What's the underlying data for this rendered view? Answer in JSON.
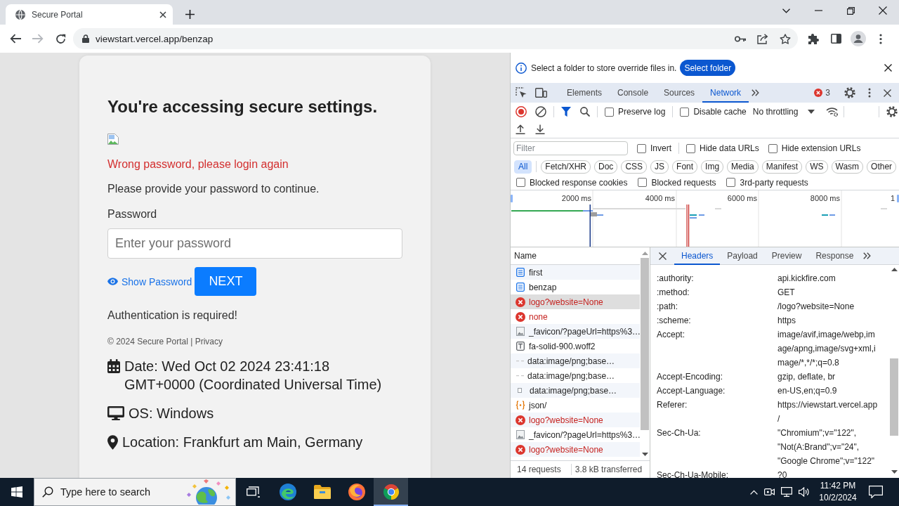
{
  "browser": {
    "tab_title": "Secure Portal",
    "url": "viewstart.vercel.app/benzap"
  },
  "page": {
    "heading": "You're accessing secure settings.",
    "error": "Wrong password, please login again",
    "prompt": "Please provide your password to continue.",
    "password_label": "Password",
    "password_placeholder": "Enter your password",
    "show_password": "Show Password",
    "next": "NEXT",
    "auth_note": "Authentication is required!",
    "footer": "© 2024 Secure Portal | Privacy",
    "info": [
      {
        "kind": "date",
        "text": "Date: Wed Oct 02 2024 23:41:18 GMT+0000 (Coordinated Universal Time)"
      },
      {
        "kind": "os",
        "text": "OS: Windows"
      },
      {
        "kind": "location",
        "text": "Location: Frankfurt am Main, Germany"
      }
    ]
  },
  "devtools": {
    "infobar": {
      "message": "Select a folder to store override files in.",
      "button": "Select folder"
    },
    "tabs": [
      {
        "label": "Elements",
        "selected": false
      },
      {
        "label": "Console",
        "selected": false
      },
      {
        "label": "Sources",
        "selected": false
      },
      {
        "label": "Network",
        "selected": true
      }
    ],
    "error_count": "3",
    "toolbar": {
      "recording": true,
      "checks": [
        {
          "label": "Preserve log",
          "checked": false
        },
        {
          "label": "Disable cache",
          "checked": false
        }
      ],
      "throttling": "No throttling"
    },
    "filter": {
      "placeholder": "Filter",
      "checks": [
        {
          "label": "Invert",
          "checked": false
        },
        {
          "label": "Hide data URLs",
          "checked": false
        },
        {
          "label": "Hide extension URLs",
          "checked": false
        }
      ],
      "types": [
        {
          "label": "All",
          "selected": true
        },
        {
          "label": "Fetch/XHR",
          "selected": false
        },
        {
          "label": "Doc",
          "selected": false
        },
        {
          "label": "CSS",
          "selected": false
        },
        {
          "label": "JS",
          "selected": false
        },
        {
          "label": "Font",
          "selected": false
        },
        {
          "label": "Img",
          "selected": false
        },
        {
          "label": "Media",
          "selected": false
        },
        {
          "label": "Manifest",
          "selected": false
        },
        {
          "label": "WS",
          "selected": false
        },
        {
          "label": "Wasm",
          "selected": false
        },
        {
          "label": "Other",
          "selected": false
        }
      ],
      "more_checks": [
        {
          "label": "Blocked response cookies",
          "checked": false
        },
        {
          "label": "Blocked requests",
          "checked": false
        },
        {
          "label": "3rd-party requests",
          "checked": false
        }
      ]
    },
    "overview": {
      "ticks": [
        "2000 ms",
        "4000 ms",
        "6000 ms",
        "8000 ms",
        "1"
      ]
    },
    "requests": {
      "column": "Name",
      "rows": [
        {
          "name": "first",
          "kind": "document",
          "selected": false
        },
        {
          "name": "benzap",
          "kind": "document",
          "selected": false
        },
        {
          "name": "logo?website=None",
          "kind": "error",
          "selected": true
        },
        {
          "name": "none",
          "kind": "error",
          "selected": false
        },
        {
          "name": "_favicon/?pageUrl=https%3…",
          "kind": "image",
          "selected": false
        },
        {
          "name": "fa-solid-900.woff2",
          "kind": "font",
          "selected": false
        },
        {
          "name": "data:image/png;base…",
          "kind": "data",
          "selected": false
        },
        {
          "name": "data:image/png;base…",
          "kind": "data",
          "selected": false
        },
        {
          "name": "data:image/png;base…",
          "kind": "thumbnail",
          "selected": false
        },
        {
          "name": "json/",
          "kind": "script",
          "selected": false
        },
        {
          "name": "logo?website=None",
          "kind": "error",
          "selected": false
        },
        {
          "name": "_favicon/?pageUrl=https%3…",
          "kind": "image",
          "selected": false
        },
        {
          "name": "logo?website=None",
          "kind": "error",
          "selected": false
        }
      ],
      "count": "14 requests",
      "transferred": "3.8 kB transferred"
    },
    "details": {
      "tabs": [
        {
          "label": "Headers",
          "selected": true
        },
        {
          "label": "Payload",
          "selected": false
        },
        {
          "label": "Preview",
          "selected": false
        },
        {
          "label": "Response",
          "selected": false
        }
      ],
      "headers": [
        {
          "name": ":authority:",
          "value": "api.kickfire.com"
        },
        {
          "name": ":method:",
          "value": "GET"
        },
        {
          "name": ":path:",
          "value": "/logo?website=None"
        },
        {
          "name": ":scheme:",
          "value": "https"
        },
        {
          "name": "Accept:",
          "value": "image/avif,image/webp,image/apng,image/svg+xml,image/*,*/*;q=0.8"
        },
        {
          "name": "Accept-Encoding:",
          "value": "gzip, deflate, br"
        },
        {
          "name": "Accept-Language:",
          "value": "en-US,en;q=0.9"
        },
        {
          "name": "Referer:",
          "value": "https://viewstart.vercel.app/"
        },
        {
          "name": "Sec-Ch-Ua:",
          "value": "\"Chromium\";v=\"122\", \"Not(A:Brand\";v=\"24\", \"Google Chrome\";v=\"122\""
        },
        {
          "name": "Sec-Ch-Ua-Mobile:",
          "value": "?0"
        }
      ]
    }
  },
  "taskbar": {
    "search_placeholder": "Type here to search",
    "apps": [
      {
        "kind": "taskview",
        "active": false
      },
      {
        "kind": "wave",
        "active": false
      },
      {
        "kind": "folder",
        "active": false
      },
      {
        "kind": "fox",
        "active": false
      },
      {
        "kind": "orb",
        "active": true
      }
    ],
    "time": "11:42 PM",
    "date": "10/2/2024"
  }
}
